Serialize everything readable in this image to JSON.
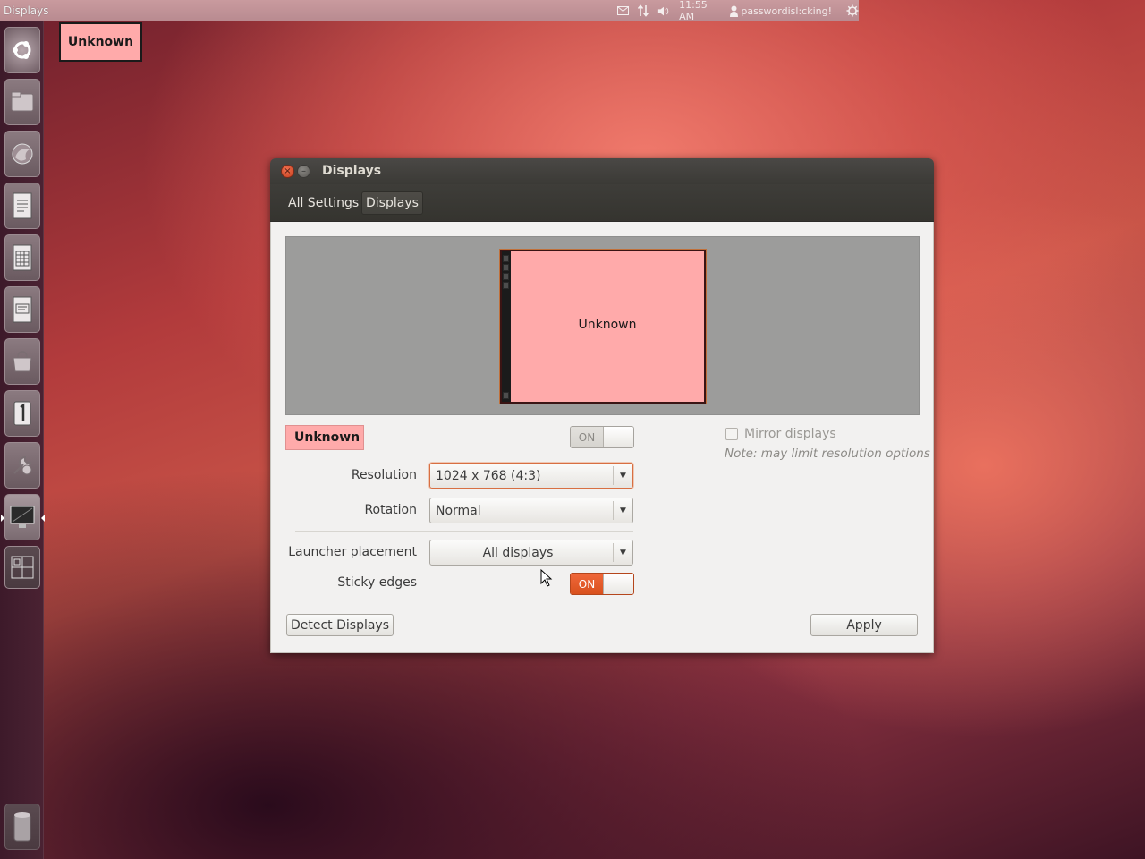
{
  "top_panel": {
    "app_title": "Displays",
    "clock": "11:55 AM",
    "user": "passwordisl:cking!",
    "icons": [
      "mail-icon",
      "network-icon",
      "volume-icon",
      "user-icon",
      "power-gear-icon"
    ]
  },
  "launcher": {
    "items": [
      {
        "name": "dash-home"
      },
      {
        "name": "files"
      },
      {
        "name": "firefox"
      },
      {
        "name": "writer"
      },
      {
        "name": "calc"
      },
      {
        "name": "impress"
      },
      {
        "name": "software-center"
      },
      {
        "name": "ubuntu-one"
      },
      {
        "name": "system-settings"
      },
      {
        "name": "displays"
      },
      {
        "name": "workspaces"
      },
      {
        "name": "trash"
      }
    ]
  },
  "monitor_overlay_label": "Unknown",
  "window": {
    "title": "Displays",
    "breadcrumbs": [
      "All Settings",
      "Displays"
    ],
    "preview": {
      "monitor_name": "Unknown",
      "monitor_color": "#ffaaaa"
    },
    "display_name_tag": "Unknown",
    "display_power_switch": {
      "label": "ON",
      "state": "off"
    },
    "mirror": {
      "label": "Mirror displays",
      "checked": false,
      "note": "Note: may limit resolution options"
    },
    "resolution": {
      "label": "Resolution",
      "value": "1024 x 768 (4:3)"
    },
    "rotation": {
      "label": "Rotation",
      "value": "Normal"
    },
    "launcher_placement": {
      "label": "Launcher placement",
      "value": "All displays"
    },
    "sticky_edges": {
      "label": "Sticky edges",
      "switch_label": "ON",
      "state": "on"
    },
    "detect_button": "Detect Displays",
    "apply_button": "Apply"
  },
  "colors": {
    "accent": "#dd5522",
    "monitor": "#ffaaaa"
  }
}
